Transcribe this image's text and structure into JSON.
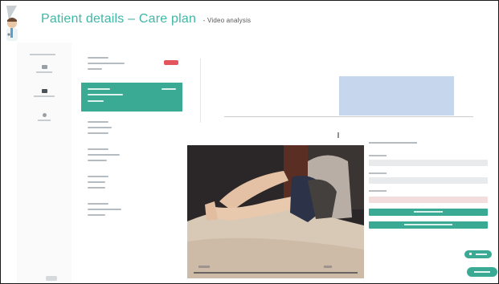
{
  "header": {
    "title": "Patient details – Care plan",
    "subtitle": "- Video analysis",
    "avatar_icon": "doctor-avatar-icon"
  },
  "colors": {
    "accent": "#3fb6a6",
    "selected": "#3aaa94",
    "danger": "#e3545d",
    "bar": "#c6d6ec",
    "video_bg": "#2a2628"
  },
  "nav": {
    "items": [
      {
        "icon": "grid-icon"
      },
      {
        "icon": "monitor-icon"
      },
      {
        "icon": "person-icon"
      }
    ]
  },
  "records": {
    "count": 6,
    "selected_index": 1
  },
  "chart_data": {
    "type": "bar",
    "categories": [
      ""
    ],
    "values": [
      1
    ],
    "title": "",
    "xlabel": "",
    "ylabel": ""
  },
  "video": {
    "state": "paused"
  },
  "form": {
    "fields": 3,
    "error_field_index": 2,
    "buttons": 2
  },
  "fabs": [
    {
      "icon": "plus-icon"
    },
    {
      "icon": "check-icon"
    }
  ]
}
